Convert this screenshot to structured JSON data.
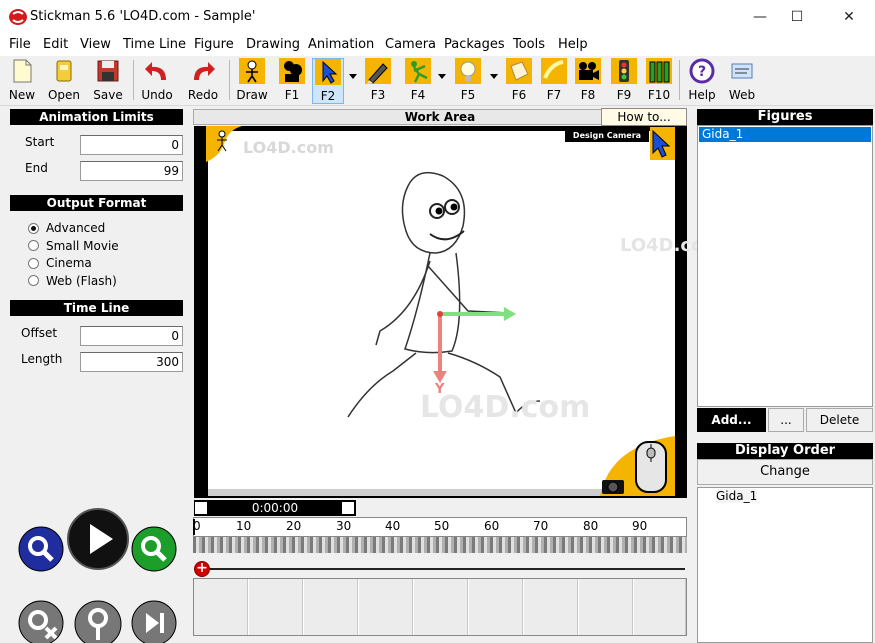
{
  "window": {
    "title": "Stickman 5.6  'LO4D.com - Sample'",
    "minimize": "—",
    "maximize": "☐",
    "close": "✕"
  },
  "menu": [
    "File",
    "Edit",
    "View",
    "Time Line",
    "Figure",
    "Drawing",
    "Animation",
    "Camera",
    "Packages",
    "Tools",
    "Help"
  ],
  "toolbar": {
    "new": "New",
    "open": "Open",
    "save": "Save",
    "undo": "Undo",
    "redo": "Redo",
    "draw": "Draw",
    "f1": "F1",
    "f2": "F2",
    "f3": "F3",
    "f4": "F4",
    "f5": "F5",
    "f6": "F6",
    "f7": "F7",
    "f8": "F8",
    "f9": "F9",
    "f10": "F10",
    "help": "Help",
    "web": "Web"
  },
  "animation_limits": {
    "header": "Animation Limits",
    "start_label": "Start",
    "start_value": "0",
    "end_label": "End",
    "end_value": "99"
  },
  "output_format": {
    "header": "Output Format",
    "options": [
      "Advanced",
      "Small Movie",
      "Cinema",
      "Web (Flash)"
    ],
    "selected": "Advanced"
  },
  "time_line": {
    "header": "Time Line",
    "offset_label": "Offset",
    "offset_value": "0",
    "length_label": "Length",
    "length_value": "300",
    "time": "0:00:00",
    "ticks": [
      "0",
      "10",
      "20",
      "30",
      "40",
      "50",
      "60",
      "70",
      "80",
      "90"
    ]
  },
  "work_area": {
    "header": "Work Area",
    "how_to": "How to...",
    "design_camera": "Design Camera",
    "axis_y": "Y"
  },
  "figures": {
    "header": "Figures",
    "items": [
      "Gida_1"
    ],
    "add_button": "Add...",
    "more_button": "...",
    "delete_button": "Delete"
  },
  "display_order": {
    "header": "Display Order",
    "change_button": "Change",
    "items": [
      "Gida_1"
    ]
  },
  "watermark": "LO4D.com",
  "colors": {
    "selection": "#0078d7",
    "axis_x": "#7fe07f",
    "axis_y": "#f08080",
    "accent_yellow": "#f4b400"
  }
}
